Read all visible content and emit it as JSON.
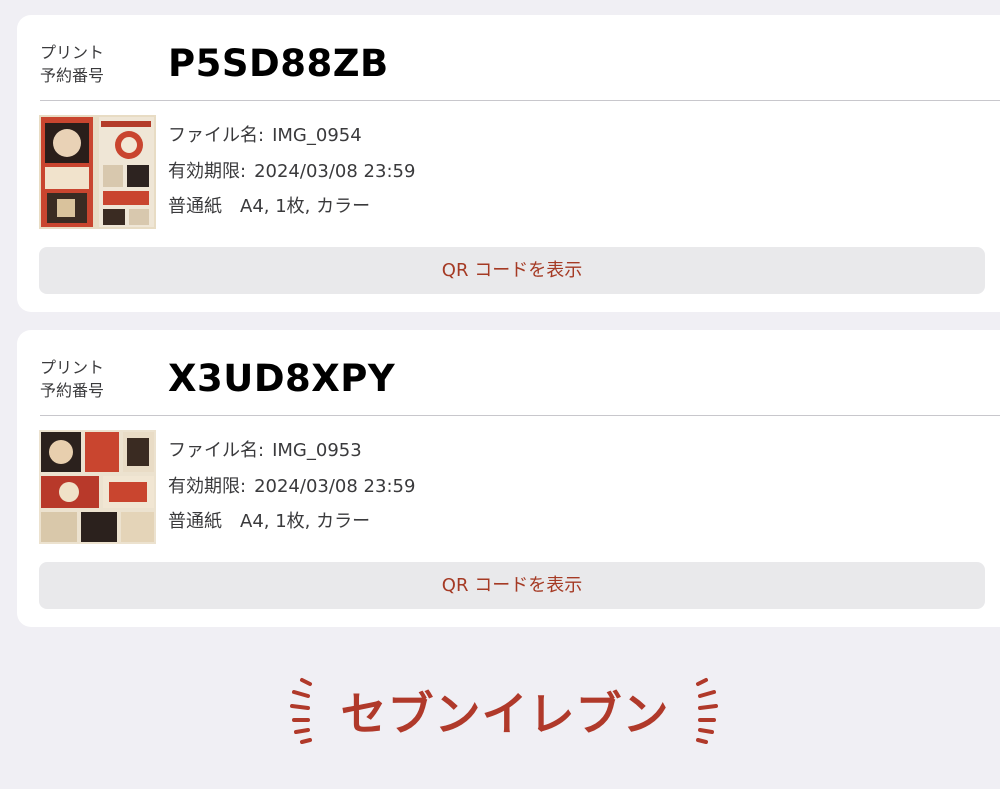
{
  "reservations": [
    {
      "label_line1": "プリント",
      "label_line2": "予約番号",
      "number": "P5SD88ZB",
      "file_label": "ファイル名:",
      "file_name": "IMG_0954",
      "expiry_label": "有効期限:",
      "expiry": "2024/03/08 23:59",
      "paper_label": "普通紙",
      "paper_spec": "A4, 1枚, カラー",
      "qr_button": "QR コードを表示",
      "thumbnail_icon": "manga-page-thumbnail"
    },
    {
      "label_line1": "プリント",
      "label_line2": "予約番号",
      "number": "X3UD8XPY",
      "file_label": "ファイル名:",
      "file_name": "IMG_0953",
      "expiry_label": "有効期限:",
      "expiry": "2024/03/08 23:59",
      "paper_label": "普通紙",
      "paper_spec": "A4, 1枚, カラー",
      "qr_button": "QR コードを表示",
      "thumbnail_icon": "manga-page-thumbnail"
    }
  ],
  "store_annotation": {
    "text": "セブンイレブン",
    "color": "#b0392a"
  },
  "colors": {
    "background": "#f0eff4",
    "card": "#ffffff",
    "button_bg": "#e9e9eb",
    "button_text": "#a53a24"
  }
}
